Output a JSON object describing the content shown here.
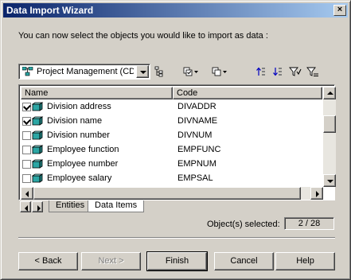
{
  "window": {
    "title": "Data Import Wizard"
  },
  "instruction": "You can now select the objects you would like to import as data :",
  "model_selector": {
    "value": "Project Management (CDM)"
  },
  "columns": {
    "name": "Name",
    "code": "Code"
  },
  "rows": [
    {
      "name": "Division address",
      "code": "DIVADDR",
      "checked": true
    },
    {
      "name": "Division name",
      "code": "DIVNAME",
      "checked": true
    },
    {
      "name": "Division number",
      "code": "DIVNUM",
      "checked": false
    },
    {
      "name": "Employee function",
      "code": "EMPFUNC",
      "checked": false
    },
    {
      "name": "Employee number",
      "code": "EMPNUM",
      "checked": false
    },
    {
      "name": "Employee salary",
      "code": "EMPSAL",
      "checked": false
    }
  ],
  "tabs": [
    {
      "label": "Entities",
      "active": false
    },
    {
      "label": "Data Items",
      "active": true
    }
  ],
  "selection": {
    "label": "Object(s) selected:",
    "value": "2 / 28"
  },
  "buttons": {
    "back": "< Back",
    "next": "Next >",
    "finish": "Finish",
    "cancel": "Cancel",
    "help": "Help"
  },
  "colors": {
    "title_start": "#0a246a",
    "title_end": "#a6caf0",
    "face": "#d4d0c8",
    "entity_icon": "#2ca6a4"
  },
  "icons": [
    "close-icon",
    "model-icon",
    "dropdown-arrow-icon",
    "hierarchy-icon",
    "select-all-icon",
    "deselect-all-icon",
    "move-up-icon",
    "move-down-icon",
    "filter-icon",
    "clear-filter-icon",
    "entity-icon"
  ]
}
